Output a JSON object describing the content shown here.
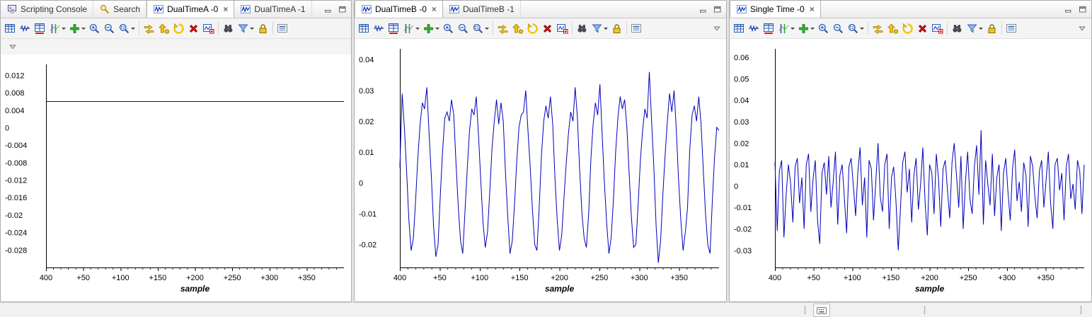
{
  "panels": [
    {
      "name": "left",
      "tabs": [
        {
          "label": "Scripting Console",
          "icon": "console-icon",
          "active": false,
          "closable": false
        },
        {
          "label": "Search",
          "icon": "search-flashlight-icon",
          "active": false,
          "closable": false
        },
        {
          "label": "DualTimeA -0",
          "icon": "waveform-icon",
          "active": true,
          "closable": true
        },
        {
          "label": "DualTimeA -1",
          "icon": "waveform-icon",
          "active": false,
          "closable": false
        }
      ],
      "overflow_row": true,
      "chart_index": 0
    },
    {
      "name": "middle",
      "tabs": [
        {
          "label": "DualTimeB -0",
          "icon": "waveform-icon",
          "active": true,
          "closable": true
        },
        {
          "label": "DualTimeB -1",
          "icon": "waveform-icon",
          "active": false,
          "closable": false
        }
      ],
      "overflow_row": false,
      "chart_index": 1
    },
    {
      "name": "right",
      "tabs": [
        {
          "label": "Single Time -0",
          "icon": "waveform-icon",
          "active": true,
          "closable": true
        }
      ],
      "overflow_row": false,
      "chart_index": 2
    }
  ],
  "toolbar": {
    "items": [
      {
        "icon": "graph-properties-icon"
      },
      {
        "icon": "center-waveform-icon"
      },
      {
        "icon": "data-table-icon"
      },
      {
        "icon": "cursor-mode-icon",
        "dropdown": true
      },
      {
        "icon": "add-trace-icon",
        "dropdown": true
      },
      {
        "icon": "zoom-in-icon"
      },
      {
        "icon": "zoom-out-icon"
      },
      {
        "icon": "zoom-select-icon",
        "dropdown": true
      },
      {
        "separator": true
      },
      {
        "icon": "sync-refresh-icon"
      },
      {
        "icon": "sync-forward-icon"
      },
      {
        "icon": "sync-all-icon"
      },
      {
        "icon": "clear-icon"
      },
      {
        "icon": "export-chart-icon"
      },
      {
        "separator": true
      },
      {
        "icon": "find-icon"
      },
      {
        "icon": "filter-icon",
        "dropdown": true
      },
      {
        "icon": "lock-icon"
      },
      {
        "separator": true
      },
      {
        "icon": "list-view-icon"
      }
    ],
    "view_menu_icon": "view-menu-chevron-icon"
  },
  "chart_data": [
    {
      "type": "line",
      "title": "DualTimeA -0",
      "xlabel": "sample",
      "x_tick_labels": [
        "400",
        "+50",
        "+100",
        "+150",
        "+200",
        "+250",
        "+300",
        "+350"
      ],
      "x_range": [
        0,
        400
      ],
      "ytick_labels": [
        "0.012",
        "0.008",
        "0.004",
        "0",
        "-0.004",
        "-0.008",
        "-0.012",
        "-0.016",
        "-0.02",
        "-0.024",
        "-0.028"
      ],
      "ylim": [
        -0.032,
        0.0145
      ],
      "line_color": "#0000cc",
      "grid": false,
      "values": [
        0.006,
        0.006
      ]
    },
    {
      "type": "line",
      "title": "DualTimeB -0",
      "xlabel": "sample",
      "x_tick_labels": [
        "400",
        "+50",
        "+100",
        "+150",
        "+200",
        "+250",
        "+300",
        "+350"
      ],
      "x_range": [
        0,
        400
      ],
      "ytick_labels": [
        "0.04",
        "0.03",
        "0.02",
        "0.01",
        "0",
        "-0.01",
        "-0.02"
      ],
      "ylim": [
        -0.0275,
        0.0435
      ],
      "line_color": "#0000bb",
      "grid": false,
      "values": [
        0.005,
        0.029,
        0.018,
        0.004,
        -0.012,
        -0.022,
        -0.018,
        -0.006,
        0.008,
        0.019,
        0.026,
        0.024,
        0.031,
        0.016,
        0.002,
        -0.014,
        -0.024,
        -0.02,
        -0.004,
        0.01,
        0.021,
        0.023,
        0.02,
        0.027,
        0.022,
        0.006,
        -0.008,
        -0.019,
        -0.023,
        -0.009,
        0.005,
        0.017,
        0.024,
        0.022,
        0.028,
        0.015,
        0.001,
        -0.013,
        -0.021,
        -0.016,
        -0.003,
        0.011,
        0.02,
        0.027,
        0.019,
        0.026,
        0.02,
        0.003,
        -0.011,
        -0.023,
        -0.019,
        -0.007,
        0.007,
        0.018,
        0.022,
        0.023,
        0.03,
        0.017,
        0.005,
        -0.009,
        -0.02,
        -0.022,
        -0.008,
        0.009,
        0.02,
        0.025,
        0.021,
        0.028,
        0.019,
        0.002,
        -0.012,
        -0.022,
        -0.017,
        -0.005,
        0.006,
        0.016,
        0.023,
        0.02,
        0.031,
        0.021,
        0.004,
        -0.01,
        -0.018,
        -0.021,
        -0.01,
        0.008,
        0.019,
        0.026,
        0.022,
        0.032,
        0.016,
        0,
        -0.013,
        -0.023,
        -0.018,
        -0.006,
        0.01,
        0.021,
        0.028,
        0.024,
        0.027,
        0.018,
        0.003,
        -0.011,
        -0.021,
        -0.02,
        -0.007,
        0.007,
        0.017,
        0.024,
        0.021,
        0.036,
        0.02,
        0.005,
        -0.014,
        -0.026,
        -0.019,
        -0.004,
        0.009,
        0.02,
        0.029,
        0.023,
        0.03,
        0.017,
        0.001,
        -0.012,
        -0.022,
        -0.016,
        -0.008,
        0.011,
        0.022,
        0.025,
        0.02,
        0.028,
        0.019,
        0.004,
        -0.01,
        -0.02,
        -0.023,
        -0.006,
        0.008,
        0.018,
        0.017
      ]
    },
    {
      "type": "line",
      "title": "Single Time -0",
      "xlabel": "sample",
      "x_tick_labels": [
        "400",
        "+50",
        "+100",
        "+150",
        "+200",
        "+250",
        "+300",
        "+350"
      ],
      "x_range": [
        0,
        400
      ],
      "ytick_labels": [
        "0.06",
        "0.05",
        "0.04",
        "0.03",
        "0.02",
        "0.01",
        "0",
        "-0.01",
        "-0.02",
        "-0.03"
      ],
      "ylim": [
        -0.038,
        0.064
      ],
      "line_color": "#0000bb",
      "grid": false,
      "values": [
        0.011,
        -0.021,
        0.007,
        0.012,
        -0.024,
        -0.004,
        0.01,
        0.001,
        -0.017,
        0.009,
        0.013,
        -0.008,
        0.004,
        -0.02,
        0.01,
        0.015,
        -0.012,
        0.003,
        0.012,
        -0.016,
        -0.027,
        0.006,
        0.011,
        -0.004,
        0.014,
        -0.01,
        0.002,
        0.016,
        -0.018,
        0.005,
        0.01,
        -0.006,
        -0.022,
        0.009,
        0.013,
        0,
        -0.014,
        0.007,
        0.018,
        -0.009,
        0.004,
        -0.024,
        0.012,
        0.008,
        -0.016,
        0.002,
        0.02,
        -0.005,
        -0.012,
        0.01,
        0.015,
        -0.02,
        0.004,
        0.009,
        -0.007,
        -0.03,
        -0.011,
        0.011,
        0.016,
        -0.003,
        0.008,
        -0.017,
        0.005,
        0.013,
        -0.011,
        0.001,
        0.018,
        -0.008,
        -0.023,
        0.01,
        0.006,
        -0.013,
        0.015,
        0.003,
        -0.019,
        0.008,
        0.012,
        -0.002,
        -0.015,
        0.011,
        0.02,
        0.005,
        -0.01,
        0.014,
        -0.02,
        0.002,
        0.016,
        -0.006,
        -0.013,
        0.009,
        0.019,
        -0.004,
        0.026,
        -0.018,
        0.012,
        0.001,
        -0.009,
        0.015,
        -0.014,
        0.004,
        0.01,
        -0.021,
        0.006,
        0.013,
        -0.003,
        -0.016,
        0.008,
        0.017,
        -0.007,
        0.002,
        -0.012,
        0.011,
        0.005,
        -0.019,
        0.014,
        0.009,
        -0.005,
        -0.015,
        0.007,
        0.012,
        -0.01,
        0.003,
        0.016,
        -0.008,
        -0.02,
        0.01,
        0.013,
        -0.002,
        0.006,
        -0.016,
        0.009,
        0.015,
        -0.006,
        0.001,
        -0.011,
        0.012,
        0.007,
        -0.013,
        0.01
      ]
    }
  ],
  "status_bar": {
    "icons": [
      "input-mode-icon"
    ]
  },
  "colors": {
    "plot_line": "#0000bb",
    "panel_bg": "#f4f4f4",
    "chart_bg": "#ffffff"
  }
}
